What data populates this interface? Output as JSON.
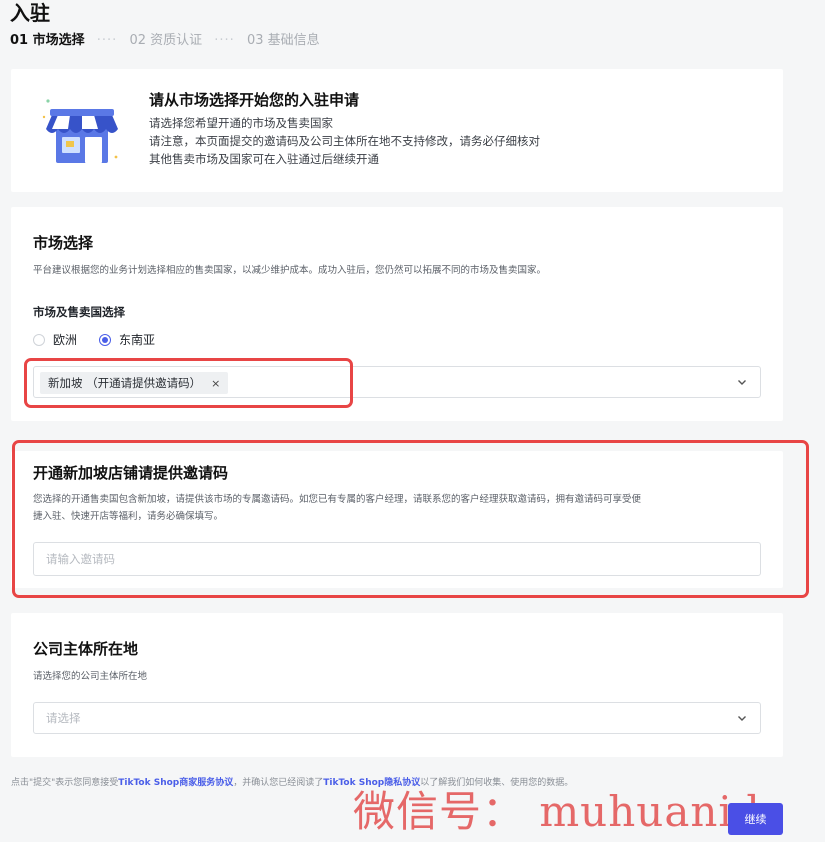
{
  "header": {
    "title": "入驻",
    "steps": [
      {
        "label": "01 市场选择",
        "active": true
      },
      {
        "label": "02 资质认证",
        "active": false
      },
      {
        "label": "03 基础信息",
        "active": false
      }
    ],
    "step_separator": "····"
  },
  "intro": {
    "title": "请从市场选择开始您的入驻申请",
    "lines": [
      "请选择您希望开通的市场及售卖国家",
      "请注意，本页面提交的邀请码及公司主体所在地不支持修改，请务必仔细核对",
      "其他售卖市场及国家可在入驻通过后继续开通"
    ],
    "illustration": "storefront-illustration"
  },
  "market": {
    "title": "市场选择",
    "description": "平台建议根据您的业务计划选择相应的售卖国家，以减少维护成本。成功入驻后，您仍然可以拓展不同的市场及售卖国家。",
    "field_label": "市场及售卖国选择",
    "radio_options": [
      {
        "label": "欧洲",
        "checked": false
      },
      {
        "label": "东南亚",
        "checked": true
      }
    ],
    "selected_tags": [
      {
        "label": "新加坡 （开通请提供邀请码）",
        "close": "×"
      }
    ]
  },
  "invite": {
    "title": "开通新加坡店铺请提供邀请码",
    "description_line1": "您选择的开通售卖国包含新加坡，请提供该市场的专属邀请码。如您已有专属的客户经理，请联系您的客户经理获取邀请码，拥有邀请码可享受便",
    "description_line2": "捷入驻、快速开店等福利，请务必确保填写。",
    "input_placeholder": "请输入邀请码"
  },
  "company": {
    "title": "公司主体所在地",
    "description": "请选择您的公司主体所在地",
    "select_placeholder": "请选择"
  },
  "footer": {
    "note_prefix": "点击\"提交\"表示您同意接受",
    "service_agreement": "TikTok Shop商家服务协议",
    "note_middle": "，并确认您已经阅读了",
    "privacy_policy": "TikTok Shop隐私协议",
    "note_suffix": "以了解我们如何收集、使用您的数据。",
    "submit_label": "继续"
  },
  "watermark": "微信号： muhuanidc",
  "colors": {
    "accent": "#4a5ee8",
    "highlight": "#e84545",
    "background": "#f5f6f7"
  }
}
